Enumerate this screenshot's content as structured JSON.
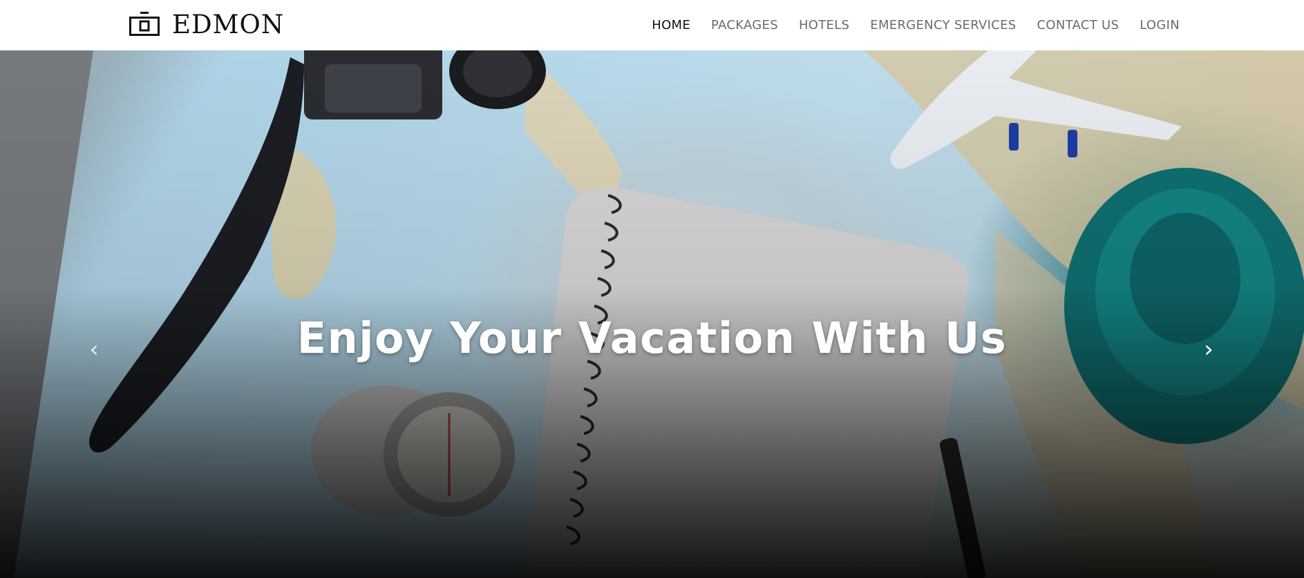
{
  "brand": {
    "name": "EDMON",
    "icon": "camera-icon"
  },
  "nav": {
    "items": [
      {
        "label": "HOME",
        "active": true
      },
      {
        "label": "PACKAGES",
        "active": false
      },
      {
        "label": "HOTELS",
        "active": false
      },
      {
        "label": "EMERGENCY SERVICES",
        "active": false
      },
      {
        "label": "CONTACT US",
        "active": false
      },
      {
        "label": "LOGIN",
        "active": false
      }
    ]
  },
  "hero": {
    "title": "Enjoy Your Vacation With Us",
    "prev_icon": "chevron-left-icon",
    "next_icon": "chevron-right-icon",
    "prev_glyph": "‹",
    "next_glyph": "›"
  },
  "colors": {
    "nav_text": "#6b6b6b",
    "nav_active": "#111111",
    "hero_text": "#ffffff"
  }
}
